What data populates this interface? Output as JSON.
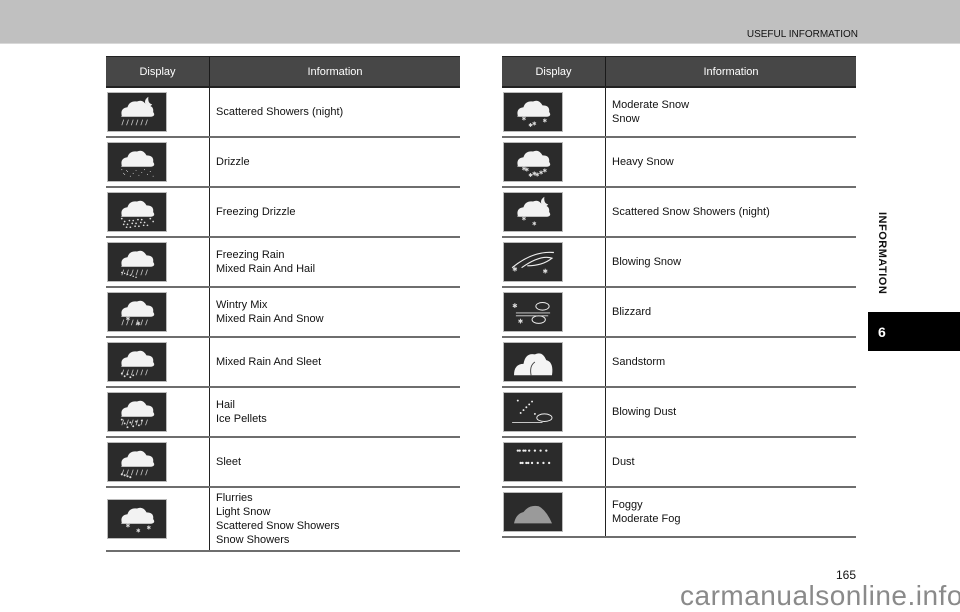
{
  "header": {
    "section_title": "USEFUL INFORMATION"
  },
  "side_tab": {
    "label": "INFORMATION",
    "chapter": "6"
  },
  "tables": {
    "left": {
      "headers": {
        "display": "Display",
        "information": "Information"
      },
      "rows": [
        {
          "icon": "scattered-showers-night-icon",
          "info": "Scattered Showers (night)"
        },
        {
          "icon": "drizzle-icon",
          "info": "Drizzle"
        },
        {
          "icon": "freezing-drizzle-icon",
          "info": "Freezing Drizzle"
        },
        {
          "icon": "freezing-rain-icon",
          "info": "Freezing Rain\nMixed Rain And Hail"
        },
        {
          "icon": "wintry-mix-icon",
          "info": "Wintry Mix\nMixed Rain And Snow"
        },
        {
          "icon": "rain-sleet-icon",
          "info": "Mixed Rain And Sleet"
        },
        {
          "icon": "hail-icon",
          "info": "Hail\nIce Pellets"
        },
        {
          "icon": "sleet-icon",
          "info": "Sleet"
        },
        {
          "icon": "flurries-icon",
          "info": "Flurries\nLight Snow\nScattered Snow Showers\nSnow Showers"
        }
      ]
    },
    "right": {
      "headers": {
        "display": "Display",
        "information": "Information"
      },
      "rows": [
        {
          "icon": "moderate-snow-icon",
          "info": "Moderate Snow\nSnow"
        },
        {
          "icon": "heavy-snow-icon",
          "info": "Heavy Snow"
        },
        {
          "icon": "scattered-snow-showers-night-icon",
          "info": "Scattered Snow Showers (night)"
        },
        {
          "icon": "blowing-snow-icon",
          "info": "Blowing Snow"
        },
        {
          "icon": "blizzard-icon",
          "info": "Blizzard"
        },
        {
          "icon": "sandstorm-icon",
          "info": "Sandstorm"
        },
        {
          "icon": "blowing-dust-icon",
          "info": "Blowing Dust"
        },
        {
          "icon": "dust-icon",
          "info": "Dust"
        },
        {
          "icon": "foggy-icon",
          "info": "Foggy\nModerate Fog"
        }
      ]
    }
  },
  "footer": {
    "page_number": "165",
    "watermark": "carmanualsonline.info"
  }
}
